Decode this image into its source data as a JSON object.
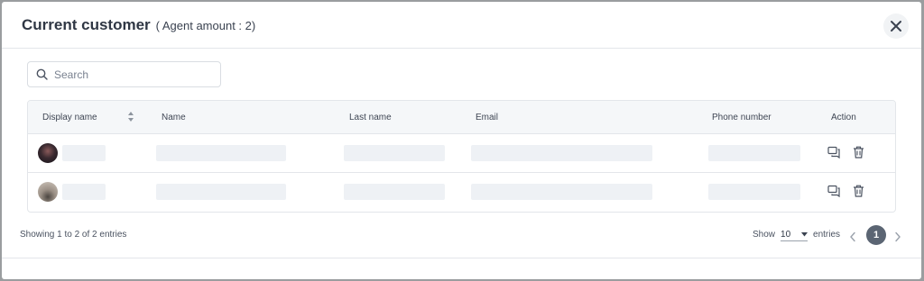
{
  "modal": {
    "title": "Current customer",
    "subtitle": "( Agent amount : 2)"
  },
  "search": {
    "placeholder": "Search"
  },
  "table": {
    "columns": [
      "Display name",
      "Name",
      "Last name",
      "Email",
      "Phone number",
      "Action"
    ]
  },
  "footer": {
    "info": "Showing 1 to 2 of 2 entries",
    "show_label": "Show",
    "page_size": "10",
    "entries_label": "entries",
    "current_page": "1"
  },
  "icons": {
    "search": "search-icon",
    "close": "close-icon",
    "sort": "sort-icon",
    "chat": "chat-icon",
    "delete": "trash-icon",
    "prev": "chevron-left-icon",
    "next": "chevron-right-icon"
  }
}
